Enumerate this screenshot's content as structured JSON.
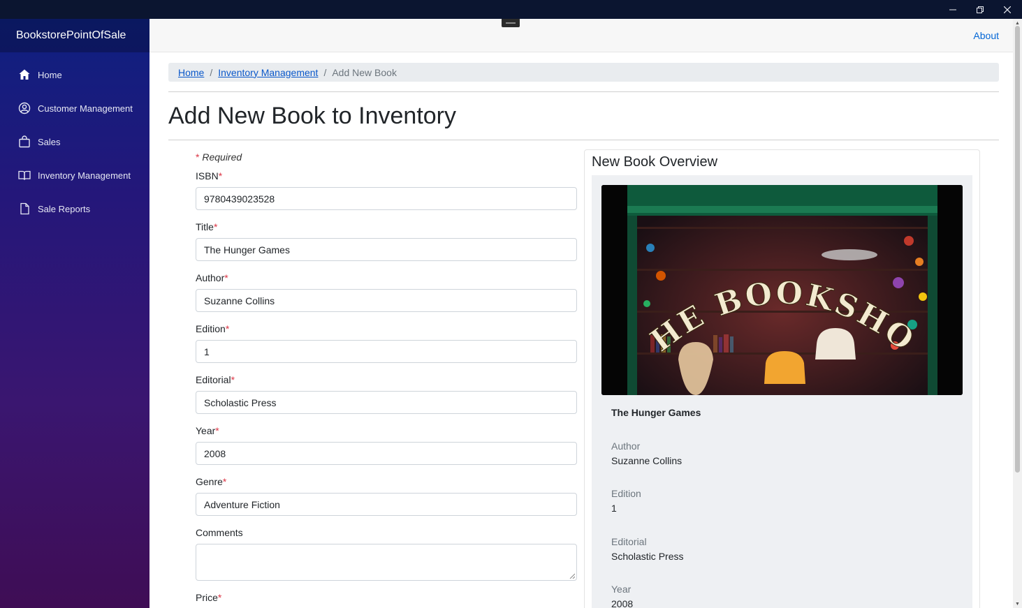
{
  "app": {
    "brand": "BookstorePointOfSale",
    "about": "About"
  },
  "sidebar": {
    "items": [
      {
        "label": "Home",
        "icon": "home-icon"
      },
      {
        "label": "Customer Management",
        "icon": "user-circle-icon"
      },
      {
        "label": "Sales",
        "icon": "shopping-bag-icon"
      },
      {
        "label": "Inventory Management",
        "icon": "book-open-icon"
      },
      {
        "label": "Sale Reports",
        "icon": "document-icon"
      }
    ]
  },
  "breadcrumb": {
    "home": "Home",
    "inventory": "Inventory Management",
    "current": "Add New Book",
    "separator": "/"
  },
  "page": {
    "title": "Add New Book to Inventory"
  },
  "form": {
    "required_star": "*",
    "required_note": "Required",
    "fields": {
      "isbn": {
        "label": "ISBN",
        "value": "9780439023528"
      },
      "title": {
        "label": "Title",
        "value": "The Hunger Games"
      },
      "author": {
        "label": "Author",
        "value": "Suzanne Collins"
      },
      "edition": {
        "label": "Edition",
        "value": "1"
      },
      "editorial": {
        "label": "Editorial",
        "value": "Scholastic Press"
      },
      "year": {
        "label": "Year",
        "value": "2008"
      },
      "genre": {
        "label": "Genre",
        "value": "Adventure Fiction"
      },
      "comments": {
        "label": "Comments",
        "value": ""
      },
      "price": {
        "label": "Price"
      }
    }
  },
  "overview": {
    "heading": "New Book Overview",
    "cover_text": "THE BOOKSHOP",
    "book_title": "The Hunger Games",
    "author_label": "Author",
    "author_value": "Suzanne Collins",
    "edition_label": "Edition",
    "edition_value": "1",
    "editorial_label": "Editorial",
    "editorial_value": "Scholastic Press",
    "year_label": "Year",
    "year_value": "2008"
  },
  "colors": {
    "link": "#0366d6",
    "required": "#dc3545",
    "sidebar_top": "#0e2080",
    "sidebar_bottom": "#3f0d55"
  }
}
